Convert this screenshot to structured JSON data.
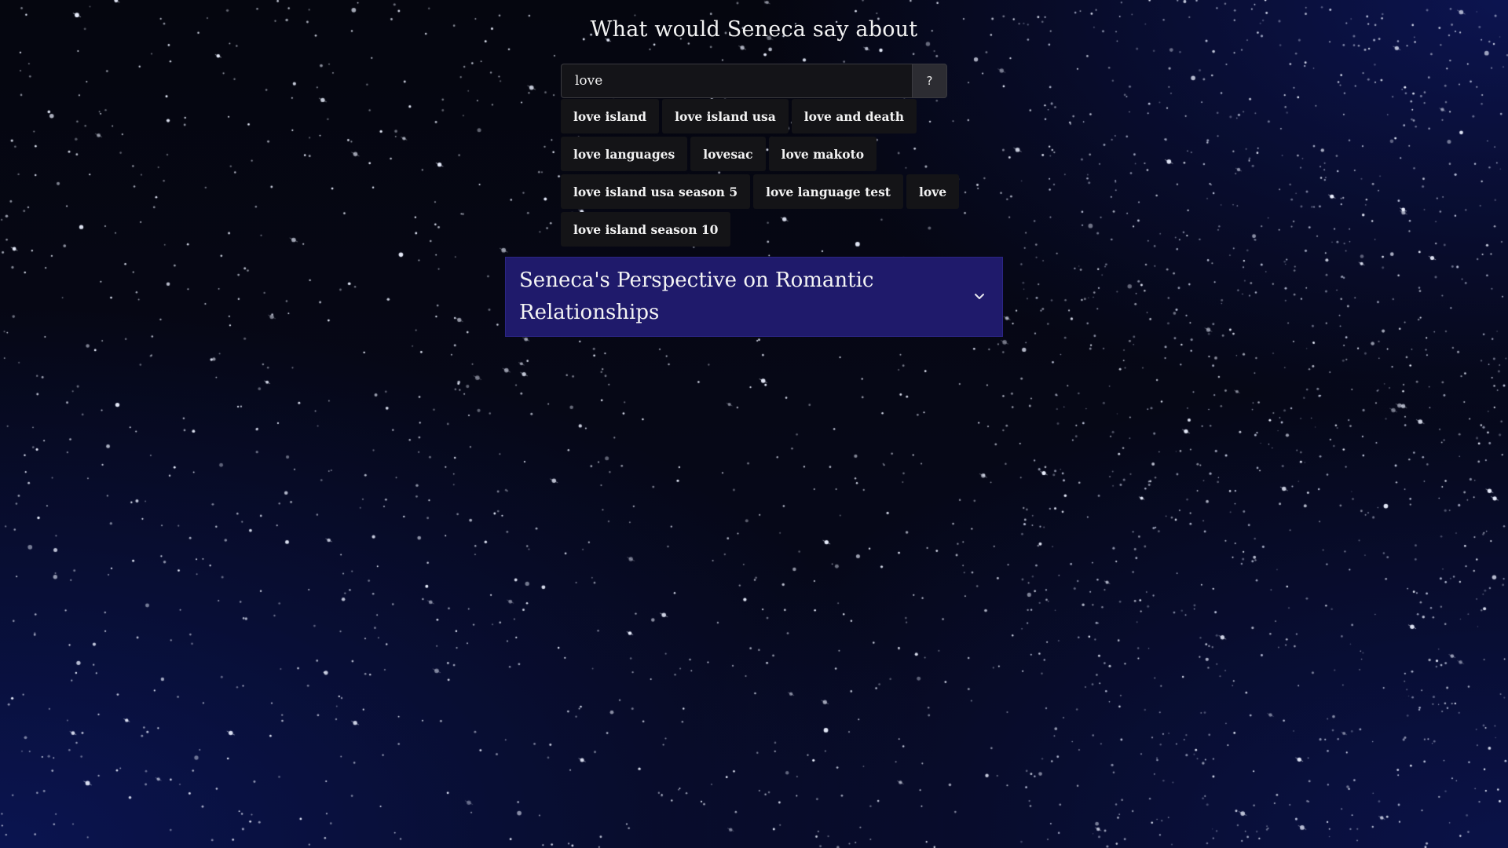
{
  "header": {
    "title": "What would Seneca say about"
  },
  "search": {
    "value": "love",
    "submit_label": "?"
  },
  "suggestions": {
    "rows": [
      [
        "love island",
        "love island usa",
        "love and death"
      ],
      [
        "love languages",
        "lovesac",
        "love makoto"
      ],
      [
        "love island usa season 5",
        "love language test",
        "love"
      ],
      [
        "love island season 10"
      ]
    ]
  },
  "result_panel": {
    "title": "Seneca's Perspective on Romantic Relationships",
    "toggle_icon": "chevron-down-icon",
    "background_color": "#1f1a6b"
  },
  "background": {
    "style": "starfield",
    "base_color": "#05060f",
    "accent_color": "#0a1450"
  }
}
